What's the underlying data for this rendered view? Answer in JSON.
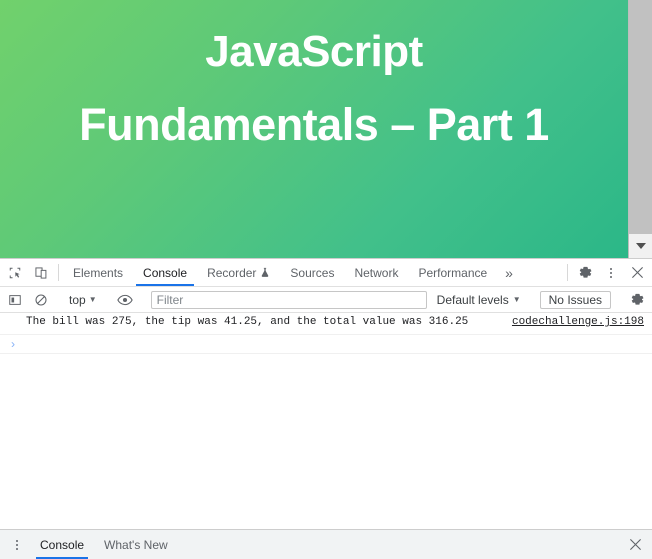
{
  "page": {
    "slide": {
      "title_line1": "JavaScript",
      "title_line2": "Fundamentals – Part 1",
      "background_gradient_from": "#71d16c",
      "background_gradient_to": "#2bb788",
      "text_color": "#ffffff"
    },
    "scrollbar": {
      "track_color": "#c1c1c1",
      "down_arrow_icon": "chevron-down-icon"
    }
  },
  "devtools": {
    "toolbar": {
      "inspect_icon": "inspect-element-icon",
      "device_toolbar_icon": "device-toolbar-icon",
      "tabs": [
        {
          "label": "Elements",
          "active": false,
          "icon": null
        },
        {
          "label": "Console",
          "active": true,
          "icon": null
        },
        {
          "label": "Recorder",
          "active": false,
          "icon": "experiment-flask-icon"
        },
        {
          "label": "Sources",
          "active": false,
          "icon": null
        },
        {
          "label": "Network",
          "active": false,
          "icon": null
        },
        {
          "label": "Performance",
          "active": false,
          "icon": null
        }
      ],
      "overflow_label": "»",
      "settings_icon": "gear-icon",
      "more_options_icon": "kebab-menu-icon",
      "close_icon": "close-icon",
      "active_tab_underline_color": "#1a73e8"
    },
    "console_toolbar": {
      "sidebar_toggle_icon": "console-sidebar-icon",
      "clear_console_icon": "clear-console-icon",
      "context_selector": "top",
      "live_expression_icon": "eye-icon",
      "filter_placeholder": "Filter",
      "filter_value": "",
      "levels_selector": "Default levels",
      "issues_button": "No Issues",
      "settings_icon": "gear-icon"
    },
    "console_messages": [
      {
        "text": "The bill was 275, the tip was 41.25, and the total value was 316.25",
        "source": "codechallenge.js:198"
      }
    ],
    "console_prompt": {
      "caret": "›",
      "value": ""
    },
    "drawer": {
      "more_options_icon": "kebab-menu-icon",
      "tabs": [
        {
          "label": "Console",
          "active": true
        },
        {
          "label": "What's New",
          "active": false
        }
      ],
      "close_icon": "close-icon"
    }
  }
}
